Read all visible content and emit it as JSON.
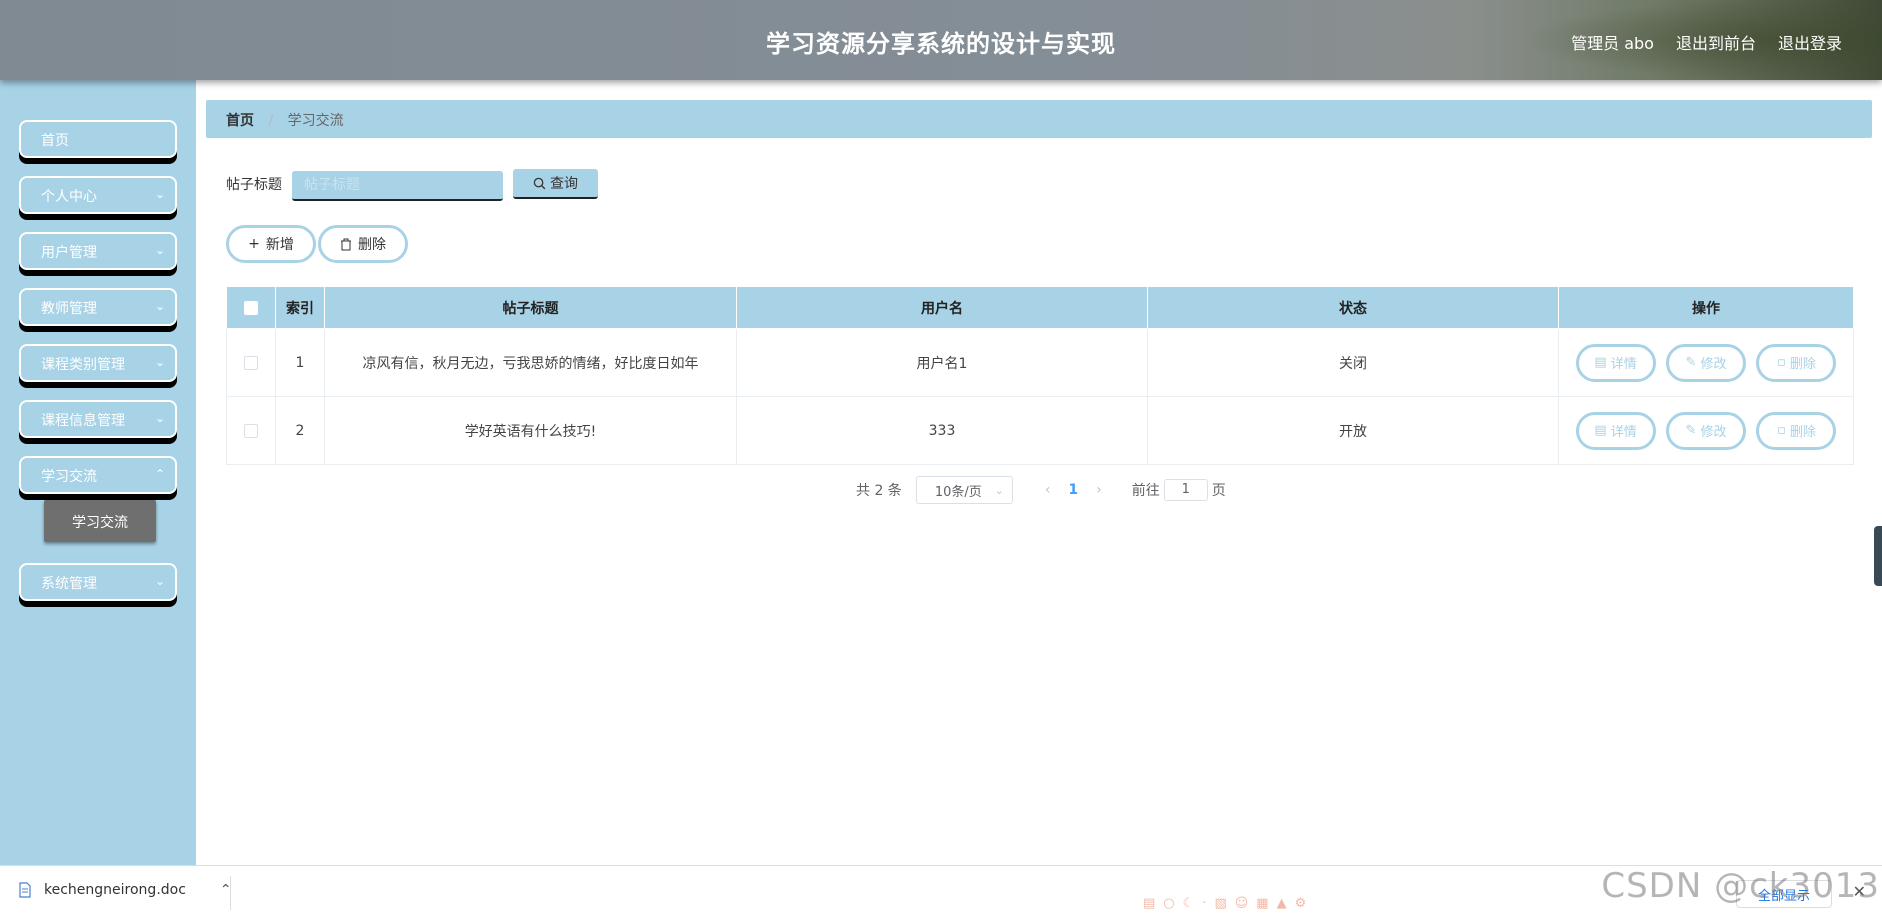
{
  "header": {
    "title": "学习资源分享系统的设计与实现",
    "user_label": "管理员 abo",
    "front_label": "退出到前台",
    "logout_label": "退出登录"
  },
  "sidebar": {
    "items": [
      {
        "label": "首页"
      },
      {
        "label": "个人中心"
      },
      {
        "label": "用户管理"
      },
      {
        "label": "教师管理"
      },
      {
        "label": "课程类别管理"
      },
      {
        "label": "课程信息管理"
      },
      {
        "label": "学习交流"
      },
      {
        "label": "系统管理"
      }
    ],
    "submenu_active": "学习交流"
  },
  "breadcrumb": {
    "home": "首页",
    "current": "学习交流"
  },
  "search": {
    "label": "帖子标题",
    "placeholder": "帖子标题",
    "button_label": "查询"
  },
  "actions": {
    "add_label": "新增",
    "delete_label": "删除"
  },
  "table": {
    "headers": [
      "索引",
      "帖子标题",
      "用户名",
      "状态",
      "操作"
    ],
    "rows": [
      {
        "index": "1",
        "title": "凉风有信，秋月无边，亏我思娇的情绪，好比度日如年",
        "username": "用户名1",
        "status": "关闭"
      },
      {
        "index": "2",
        "title": "学好英语有什么技巧!",
        "username": "333",
        "status": "开放"
      }
    ],
    "op_labels": {
      "detail": "详情",
      "edit": "修改",
      "delete": "删除"
    }
  },
  "pagination": {
    "total": "共 2 条",
    "page_size": "10条/页",
    "current_page": "1",
    "goto_prefix": "前往",
    "goto_value": "1",
    "goto_suffix": "页"
  },
  "download_bar": {
    "filename": "kechengneirong.doc",
    "show_all": "全部显示"
  },
  "watermark": "CSDN @ck3013",
  "colors": {
    "accent": "#a8d2e6",
    "header": "#858e96",
    "submenu_active": "#6f6f6f"
  }
}
